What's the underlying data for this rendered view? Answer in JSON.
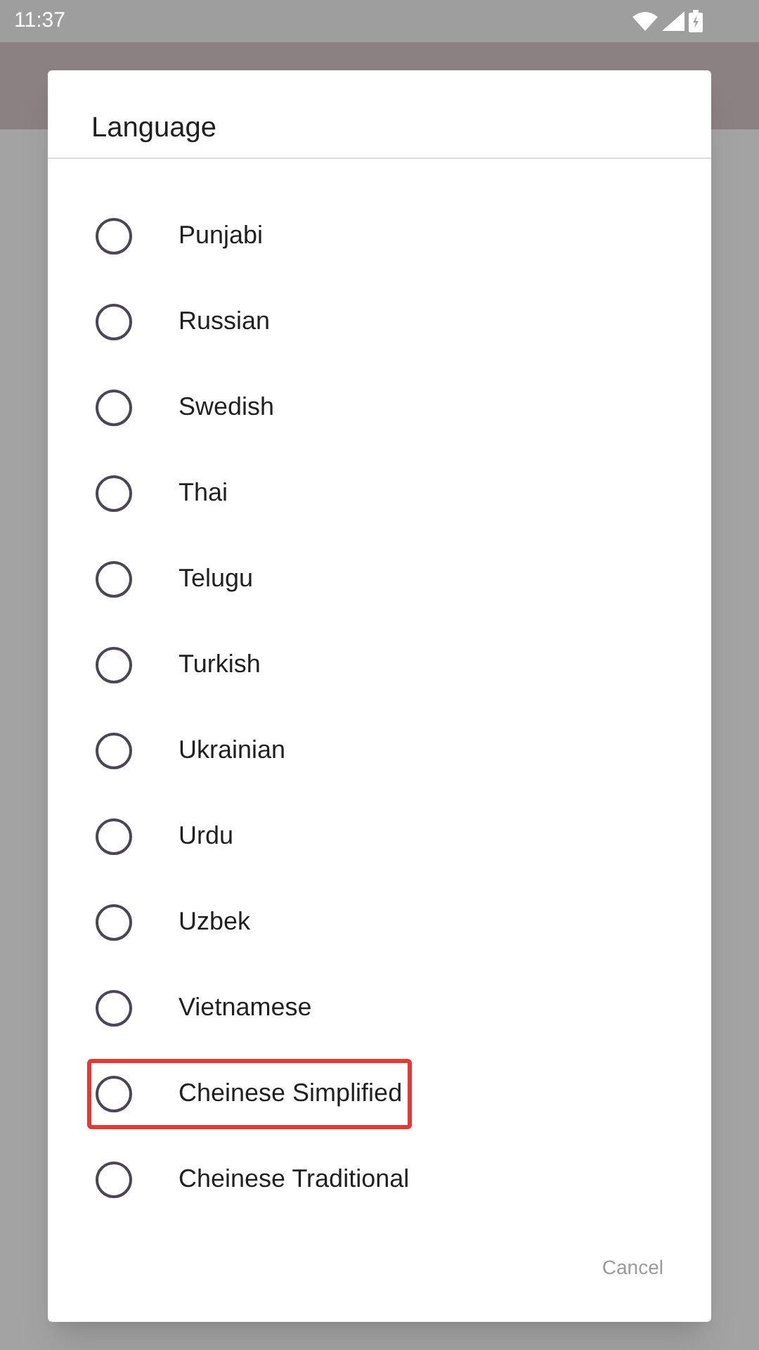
{
  "status_bar": {
    "time": "11:37"
  },
  "dialog": {
    "title": "Language",
    "options": [
      {
        "label": "Punjabi",
        "selected": false,
        "highlighted": false
      },
      {
        "label": "Russian",
        "selected": false,
        "highlighted": false
      },
      {
        "label": "Swedish",
        "selected": false,
        "highlighted": false
      },
      {
        "label": "Thai",
        "selected": false,
        "highlighted": false
      },
      {
        "label": "Telugu",
        "selected": false,
        "highlighted": false
      },
      {
        "label": "Turkish",
        "selected": false,
        "highlighted": false
      },
      {
        "label": "Ukrainian",
        "selected": false,
        "highlighted": false
      },
      {
        "label": "Urdu",
        "selected": false,
        "highlighted": false
      },
      {
        "label": "Uzbek",
        "selected": false,
        "highlighted": false
      },
      {
        "label": "Vietnamese",
        "selected": false,
        "highlighted": false
      },
      {
        "label": "Cheinese Simplified",
        "selected": false,
        "highlighted": true
      },
      {
        "label": "Cheinese Traditional",
        "selected": false,
        "highlighted": false
      }
    ],
    "cancel": {
      "label": "Cancel",
      "disabled": true
    }
  }
}
